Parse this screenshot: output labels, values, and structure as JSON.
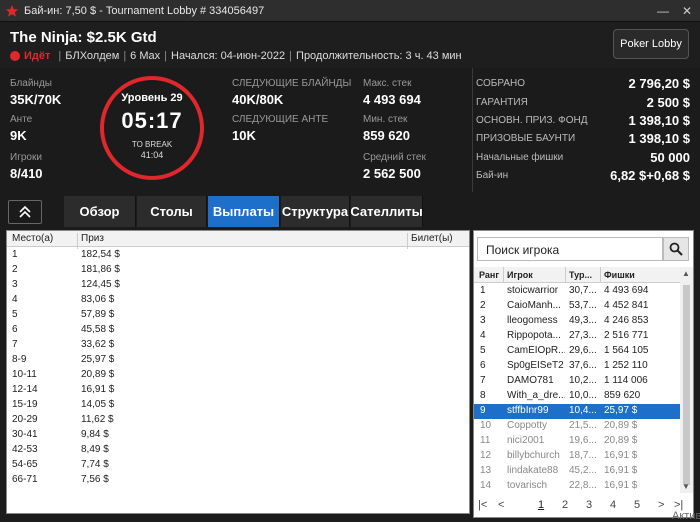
{
  "window": {
    "title": "Бай-ин: 7,50 $ - Tournament Lobby # 334056497",
    "minimize": "—",
    "close": "✕"
  },
  "tournament": {
    "name": "The Ninja: $2.5K Gtd",
    "status": "Идёт",
    "game": "БЛХолдем",
    "table_size": "6 Max",
    "started": "Начался: 04-июн-2022",
    "duration": "Продолжительность: 3 ч. 43 мин"
  },
  "lobby_button": "Poker Lobby",
  "stats": {
    "blinds_label": "Блайнды",
    "blinds": "35K/70K",
    "ante_label": "Анте",
    "ante": "9K",
    "players_label": "Игроки",
    "players": "8/410",
    "next_blinds_label": "СЛЕДУЮЩИЕ БЛАЙНДЫ",
    "next_blinds": "40K/80K",
    "next_ante_label": "СЛЕДУЮЩИЕ АНТЕ",
    "next_ante": "10K",
    "max_stack_label": "Макс. стек",
    "max_stack": "4 493 694",
    "min_stack_label": "Мин. стек",
    "min_stack": "859 620",
    "avg_stack_label": "Средний стек",
    "avg_stack": "2 562 500"
  },
  "clock": {
    "level": "Уровень 29",
    "time": "05:17",
    "to_break_label": "TO BREAK",
    "to_break": "41:04"
  },
  "prize": [
    {
      "label": "СОБРАНО",
      "value": "2 796,20 $"
    },
    {
      "label": "ГАРАНТИЯ",
      "value": "2 500 $"
    },
    {
      "label": "ОСНОВН. ПРИЗ. ФОНД",
      "value": "1 398,10 $"
    },
    {
      "label": "ПРИЗОВЫЕ БАУНТИ",
      "value": "1 398,10 $"
    },
    {
      "label": "Начальные фишки",
      "value": "50 000"
    },
    {
      "label": "Бай-ин",
      "value": "6,82 $+0,68 $"
    }
  ],
  "tabs": [
    "Обзор",
    "Столы",
    "Выплаты",
    "Структура",
    "Сателлиты"
  ],
  "active_tab": "Выплаты",
  "payouts": {
    "headers": [
      "Место(а)",
      "Приз",
      "Билет(ы)"
    ],
    "rows": [
      [
        "1",
        "182,54 $"
      ],
      [
        "2",
        "181,86 $"
      ],
      [
        "3",
        "124,45 $"
      ],
      [
        "4",
        "83,06 $"
      ],
      [
        "5",
        "57,89 $"
      ],
      [
        "6",
        "45,58 $"
      ],
      [
        "7",
        "33,62 $"
      ],
      [
        "8-9",
        "25,97 $"
      ],
      [
        "10-11",
        "20,89 $"
      ],
      [
        "12-14",
        "16,91 $"
      ],
      [
        "15-19",
        "14,05 $"
      ],
      [
        "20-29",
        "11,62 $"
      ],
      [
        "30-41",
        "9,84 $"
      ],
      [
        "42-53",
        "8,49 $"
      ],
      [
        "54-65",
        "7,74 $"
      ],
      [
        "66-71",
        "7,56 $"
      ]
    ]
  },
  "players": {
    "search_placeholder": "Поиск игрока",
    "headers": [
      "Ранг",
      "Игрок",
      "Тур...",
      "Фишки"
    ],
    "rows": [
      [
        "1",
        "stoicwarrior",
        "30,7...",
        "4 493 694"
      ],
      [
        "2",
        "CaioManh...",
        "53,7...",
        "4 452 841"
      ],
      [
        "3",
        "lleogomess",
        "49,3...",
        "4 246 853"
      ],
      [
        "4",
        "Rippopota...",
        "27,3...",
        "2 516 771"
      ],
      [
        "5",
        "CamEIOpR...",
        "29,6...",
        "1 564 105"
      ],
      [
        "6",
        "Sp0gEISeT2",
        "37,6...",
        "1 252 110"
      ],
      [
        "7",
        "DAMO781",
        "10,2...",
        "1 114 006"
      ],
      [
        "8",
        "With_a_dre...",
        "10,0...",
        "859 620"
      ],
      [
        "9",
        "stffbInr99",
        "10,4...",
        "25,97 $"
      ],
      [
        "10",
        "Coppotty",
        "21,5...",
        "20,89 $"
      ],
      [
        "11",
        "nici2001",
        "19,6...",
        "20,89 $"
      ],
      [
        "12",
        "billybchurch",
        "18,7...",
        "16,91 $"
      ],
      [
        "13",
        "lindakate88",
        "45,2...",
        "16,91 $"
      ],
      [
        "14",
        "tovarisch",
        "22,8...",
        "16,91 $"
      ]
    ],
    "pages": [
      "1",
      "2",
      "3",
      "4",
      "5"
    ]
  },
  "watermark": "Актив"
}
